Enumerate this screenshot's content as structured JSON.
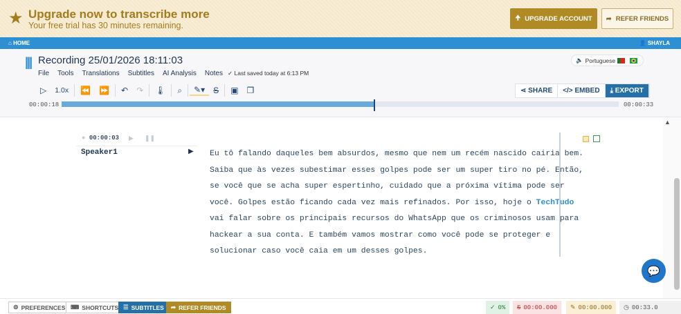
{
  "banner": {
    "title": "Upgrade now to transcribe more",
    "subtitle": "Your free trial has 30 minutes remaining.",
    "upgrade_label": "UPGRADE ACCOUNT",
    "refer_label": "REFER FRIENDS"
  },
  "nav": {
    "home": "HOME",
    "user": "SHAYLA"
  },
  "recording": {
    "title": "Recording 25/01/2026 18:11:03",
    "menu": [
      "File",
      "Tools",
      "Translations",
      "Subtitles",
      "AI Analysis",
      "Notes"
    ],
    "saved": "Last saved today at 6:13 PM",
    "language": "Portuguese",
    "speed": "1.0x"
  },
  "actions": {
    "share": "SHARE",
    "embed": "EMBED",
    "export": "EXPORT"
  },
  "player": {
    "current": "00:00:18",
    "total": "00:00:33",
    "progress": 0.56
  },
  "segment": {
    "time": "00:00:03",
    "speaker": "Speaker1",
    "lines": [
      "Eu tô falando daqueles bem absurdos, mesmo que nem um recém nascido cairia bem.",
      "Saiba que às vezes subestimar esses golpes pode ser um super tiro no pé. Então,",
      "se você que se acha super espertinho, cuidado que a próxima vítima pode ser",
      "você. Golpes estão ficando cada vez mais refinados. Por isso, hoje o "
    ],
    "link": "TechTudo",
    "lines2": [
      "vai falar sobre os principais recursos do WhatsApp que os criminosos usam para",
      "hackear a sua conta. E também vamos mostrar como você pode se proteger e",
      "solucionar caso você caia em um desses golpes."
    ]
  },
  "footer": {
    "preferences": "PREFERENCES",
    "shortcuts": "SHORTCUTS",
    "subtitles": "SUBTITLES",
    "refer": "REFER FRIENDS",
    "accuracy": "0%",
    "struck": "00:00.000",
    "highlighted": "00:00.000",
    "duration": "00:33.0"
  }
}
